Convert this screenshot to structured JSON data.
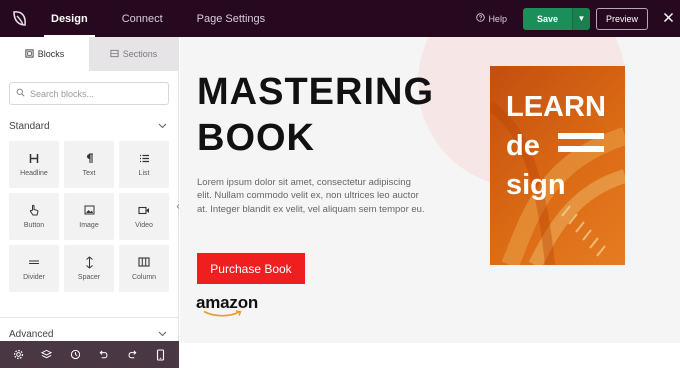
{
  "topbar": {
    "tabs": [
      "Design",
      "Connect",
      "Page Settings"
    ],
    "help_label": "Help",
    "save_label": "Save",
    "preview_label": "Preview"
  },
  "sidebar": {
    "tabs": [
      "Blocks",
      "Sections"
    ],
    "search_placeholder": "Search blocks...",
    "standard_label": "Standard",
    "advanced_label": "Advanced",
    "blocks": [
      {
        "label": "Headline",
        "icon": "heading-icon"
      },
      {
        "label": "Text",
        "icon": "paragraph-icon"
      },
      {
        "label": "List",
        "icon": "list-icon"
      },
      {
        "label": "Button",
        "icon": "pointer-icon"
      },
      {
        "label": "Image",
        "icon": "image-icon"
      },
      {
        "label": "Video",
        "icon": "video-icon"
      },
      {
        "label": "Divider",
        "icon": "divider-icon"
      },
      {
        "label": "Spacer",
        "icon": "spacer-icon"
      },
      {
        "label": "Column",
        "icon": "column-icon"
      }
    ],
    "bottom_icons": [
      "settings-icon",
      "layers-icon",
      "history-icon",
      "undo-icon",
      "redo-icon",
      "mobile-preview-icon"
    ]
  },
  "canvas": {
    "title_line1": "MASTERING",
    "title_line2": "BOOK",
    "body": "Lorem ipsum dolor sit amet, consectetur adipiscing elit. Nullam commodo velit ex, non ultrices leo auctor at. Integer blandit ex velit, vel aliquam sem tempor eu.",
    "button_label": "Purchase Book",
    "amazon_logo": "amazon",
    "book_cover": {
      "line1": "LEARN",
      "line2": "de",
      "line3": "sign"
    }
  },
  "colors": {
    "topbar": "#26091f",
    "save": "#1b8f5a",
    "button": "#f01f1f",
    "book": "#db6a14",
    "bottombar": "#4a3744"
  }
}
